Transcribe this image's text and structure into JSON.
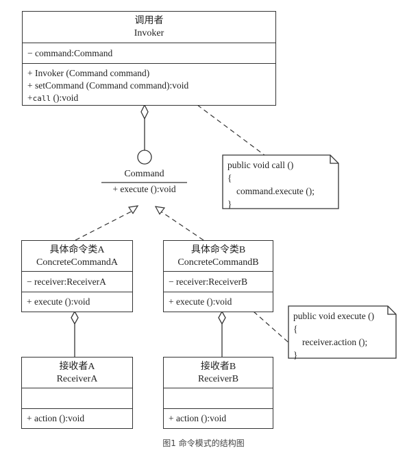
{
  "invoker": {
    "name_cn": "调用者",
    "name_en": "Invoker",
    "attributes": [
      "− command:Command"
    ],
    "operations": [
      {
        "prefix": "+ ",
        "text": "Invoker (Command command)"
      },
      {
        "prefix": "+ ",
        "text": "setCommand (Command command):void"
      },
      {
        "prefix": "+",
        "code": "call",
        "text": " ():void"
      }
    ]
  },
  "command_interface": {
    "name": "Command",
    "operation": "+ execute ():void"
  },
  "concrete_a": {
    "name_cn": "具体命令类A",
    "name_en": "ConcreteCommandA",
    "attributes": [
      "− receiver:ReceiverA"
    ],
    "operations": [
      "+ execute ():void"
    ]
  },
  "concrete_b": {
    "name_cn": "具体命令类B",
    "name_en": "ConcreteCommandB",
    "attributes": [
      "− receiver:ReceiverB"
    ],
    "operations": [
      "+ execute ():void"
    ]
  },
  "receiver_a": {
    "name_cn": "接收者A",
    "name_en": "ReceiverA",
    "attributes": [],
    "operations": [
      "+ action ():void"
    ]
  },
  "receiver_b": {
    "name_cn": "接收者B",
    "name_en": "ReceiverB",
    "attributes": [],
    "operations": [
      "+ action ():void"
    ]
  },
  "note_call": {
    "lines": [
      "public void call ()",
      "{",
      "command.execute ();",
      "}"
    ]
  },
  "note_execute": {
    "lines": [
      "public void execute ()",
      "{",
      "receiver.action ();",
      "}"
    ]
  },
  "caption": "图1 命令模式的结构图"
}
